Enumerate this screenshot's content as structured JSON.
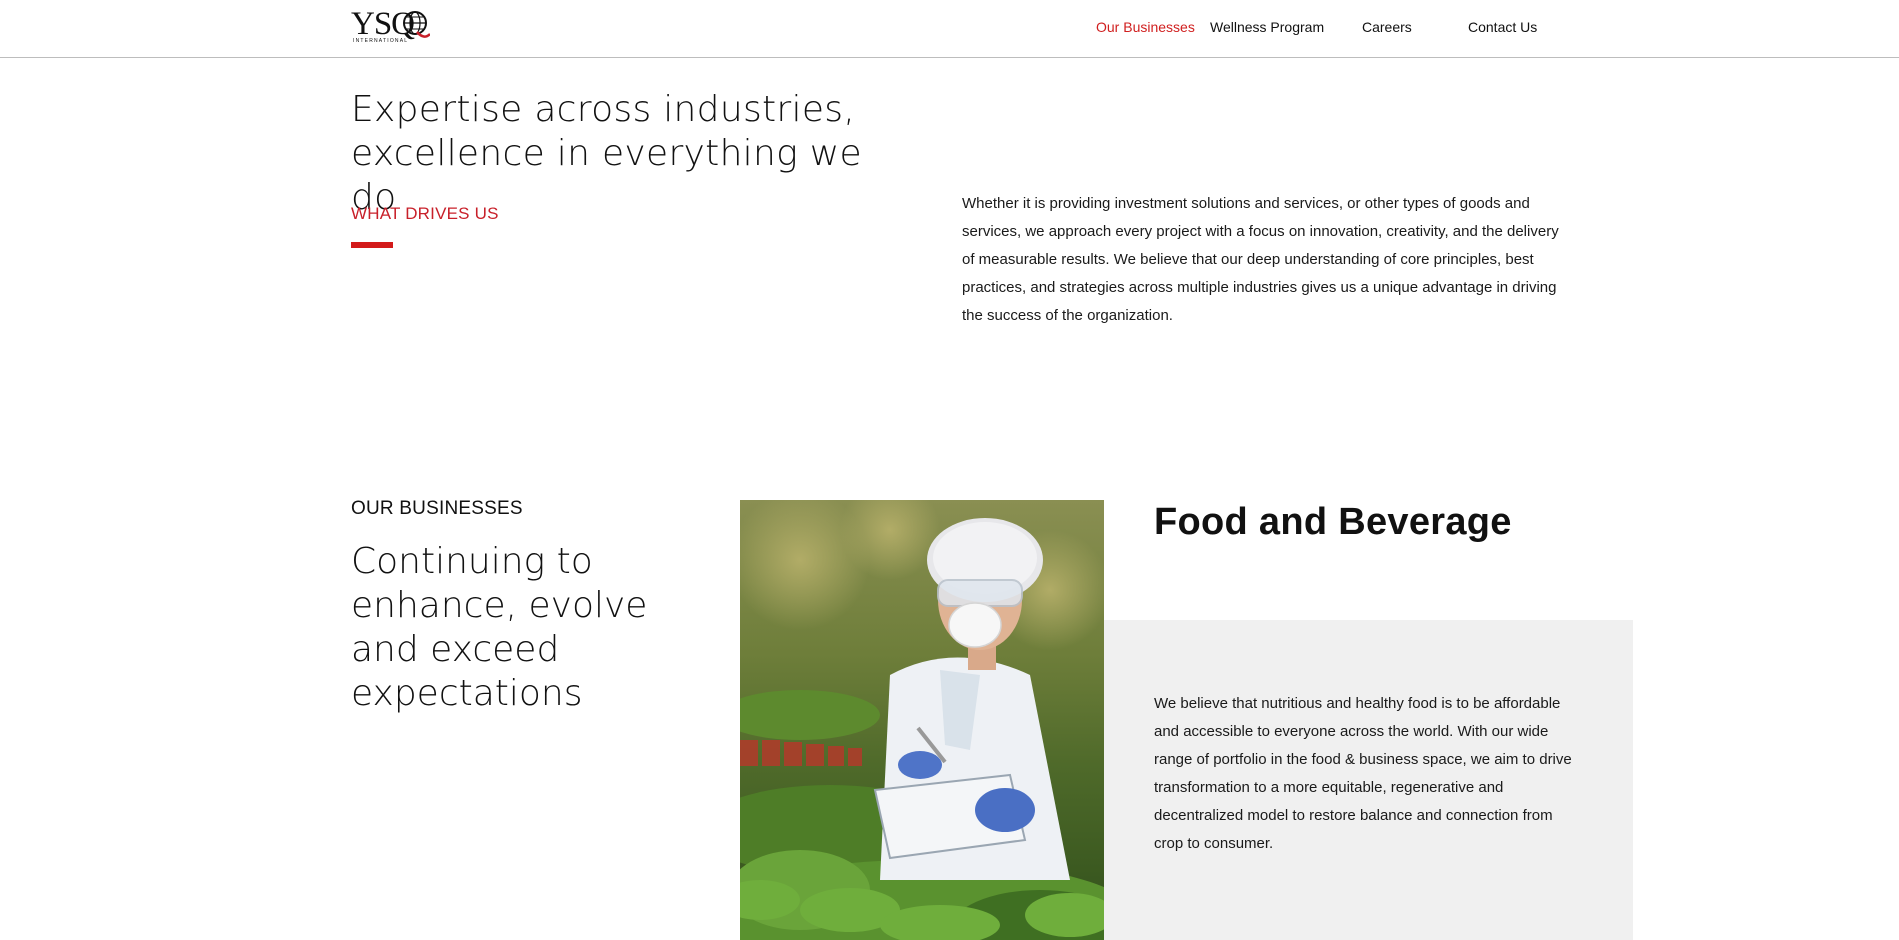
{
  "header": {
    "logo": {
      "text": "YSQ",
      "subtext": "INTERNATIONAL"
    },
    "nav": [
      {
        "label": "Our Businesses",
        "active": true
      },
      {
        "label": "Wellness Program",
        "active": false
      },
      {
        "label": "Careers",
        "active": false
      },
      {
        "label": "Contact Us",
        "active": false
      }
    ]
  },
  "intro": {
    "title": "Expertise across industries, excellence in everything we do",
    "eyebrow": "WHAT DRIVES US",
    "body": "Whether it is providing investment solutions and services, or other types of goods and services, we approach every project with a focus on innovation, creativity, and the delivery of measurable results. We believe that our deep understanding of core principles, best practices, and strategies across multiple industries gives us a unique advantage in driving the success of the organization."
  },
  "businesses": {
    "label": "OUR BUSINESSES",
    "title": "Continuing to enhance, evolve and exceed expectations",
    "card": {
      "title": "Food and Beverage",
      "body": "We believe that nutritious and healthy food is to be affordable and accessible to everyone across the world. With our wide range of portfolio in the food & business space, we aim to drive transformation to a more equitable, regenerative and decentralized model to restore balance and connection from crop to consumer."
    }
  },
  "colors": {
    "accent": "#d01f1f",
    "panel": "#f0f0f0",
    "text": "#111111"
  }
}
